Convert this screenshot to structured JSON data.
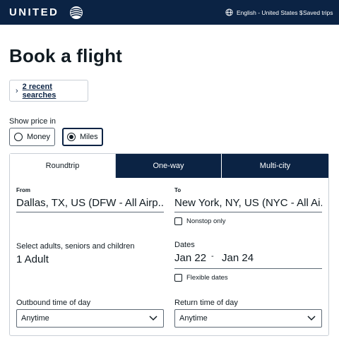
{
  "header": {
    "logo_text": "UNITED",
    "language": "English - United States $",
    "saved_trips": "Saved trips"
  },
  "page_title": "Book a flight",
  "recent_searches": {
    "chevron": "›",
    "label": "2 recent searches"
  },
  "show_price": {
    "label": "Show price in",
    "options": [
      {
        "label": "Money",
        "selected": false
      },
      {
        "label": "Miles",
        "selected": true
      }
    ]
  },
  "trip_tabs": [
    {
      "label": "Roundtrip",
      "active": true
    },
    {
      "label": "One-way",
      "active": false
    },
    {
      "label": "Multi-city",
      "active": false
    }
  ],
  "from": {
    "label": "From",
    "value": "Dallas, TX, US (DFW - All Airp..."
  },
  "to": {
    "label": "To",
    "value": "New York, NY, US (NYC - All Ai..."
  },
  "nonstop": {
    "label": "Nonstop only",
    "checked": false
  },
  "travelers": {
    "label": "Select adults, seniors and children",
    "value": "1 Adult"
  },
  "dates": {
    "label": "Dates",
    "depart": "Jan 22",
    "separator": "-",
    "return": "Jan 24"
  },
  "flexible": {
    "label": "Flexible dates",
    "checked": false
  },
  "outbound_time": {
    "label": "Outbound time of day",
    "value": "Anytime"
  },
  "return_time": {
    "label": "Return time of day",
    "value": "Anytime"
  },
  "colors": {
    "brand_navy": "#0b2344",
    "text": "#111b22",
    "border": "#c9cfd6"
  },
  "icons": [
    "united-globe-logo-icon",
    "globe-icon",
    "chevron-right-icon",
    "chevron-down-icon",
    "radio-icon",
    "checkbox-icon"
  ]
}
